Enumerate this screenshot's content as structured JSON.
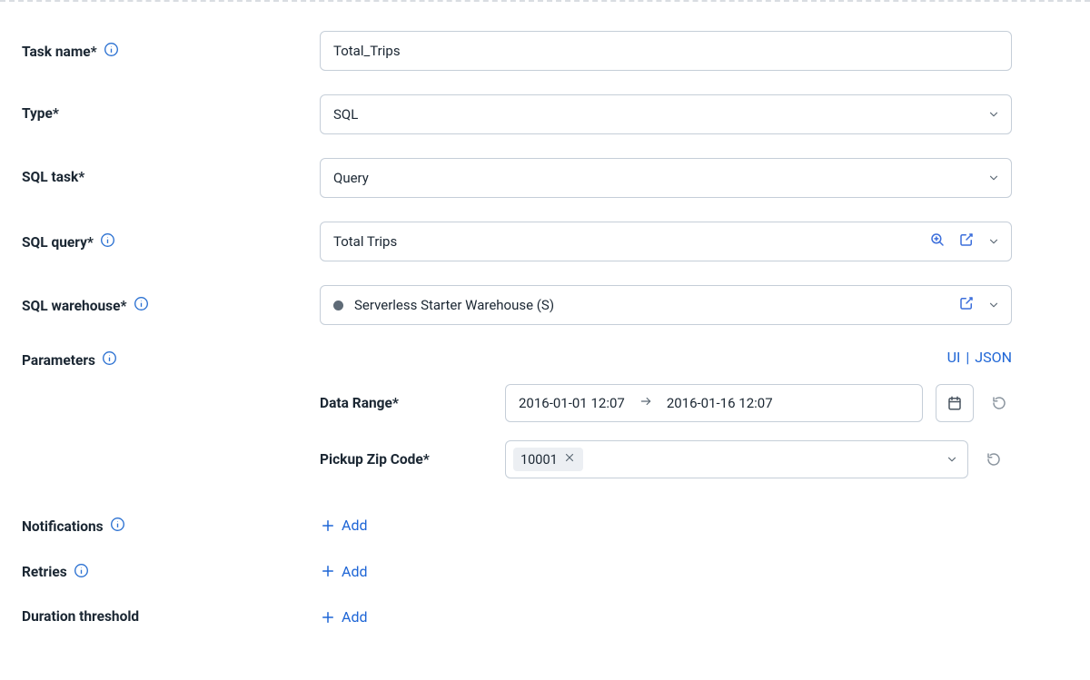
{
  "labels": {
    "task_name": "Task name*",
    "type": "Type*",
    "sql_task": "SQL task*",
    "sql_query": "SQL query*",
    "sql_warehouse": "SQL warehouse*",
    "parameters": "Parameters",
    "notifications": "Notifications",
    "retries": "Retries",
    "duration_threshold": "Duration threshold"
  },
  "values": {
    "task_name": "Total_Trips",
    "type": "SQL",
    "sql_task": "Query",
    "sql_query": "Total Trips",
    "sql_warehouse": "Serverless Starter Warehouse (S)"
  },
  "params_toggle": {
    "ui": "UI",
    "json": "JSON"
  },
  "parameters": {
    "data_range": {
      "label": "Data Range*",
      "start": "2016-01-01 12:07",
      "end": "2016-01-16 12:07"
    },
    "pickup_zip": {
      "label": "Pickup Zip Code*",
      "tags": [
        "10001"
      ]
    }
  },
  "actions": {
    "add": "Add"
  }
}
